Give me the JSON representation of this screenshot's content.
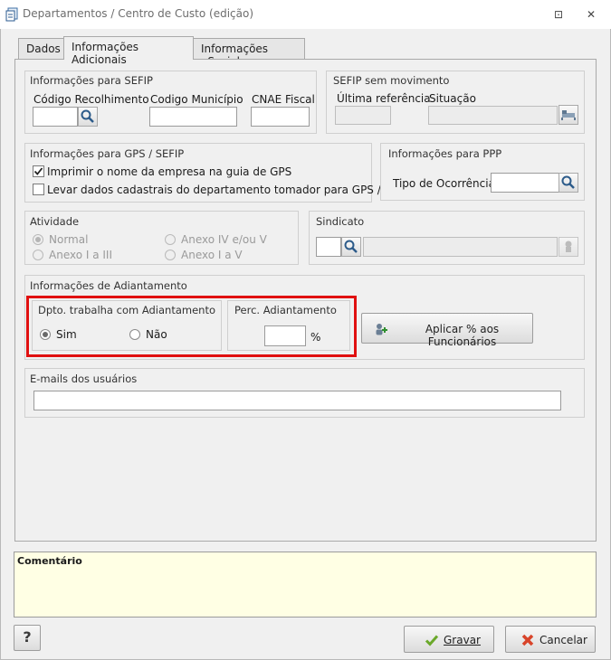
{
  "window": {
    "title": "Departamentos / Centro de Custo (edição)",
    "controls": {
      "restore": "⊡",
      "close": "✕"
    }
  },
  "tabs": [
    {
      "label": "Dados"
    },
    {
      "label": "Informações Adicionais"
    },
    {
      "label": "Informações eSocial"
    }
  ],
  "sefip": {
    "title": "Informações para SEFIP",
    "cod_recolhimento_label": "Código Recolhimento",
    "cod_municipio_label": "Codigo Município",
    "cnae_label": "CNAE Fiscal"
  },
  "sefip_mov": {
    "title": "SEFIP sem movimento",
    "ultima_ref_label": "Última referência",
    "situacao_label": "Situação"
  },
  "gps": {
    "title": "Informações para GPS / SEFIP",
    "check1_label": "Imprimir o nome da empresa na guia de GPS",
    "check2_label": "Levar dados cadastrais do departamento tomador para GPS / SEFIP"
  },
  "ppp": {
    "title": "Informações para PPP",
    "tipo_label": "Tipo de Ocorrência"
  },
  "atividade": {
    "title": "Atividade",
    "opt_normal": "Normal",
    "opt_anexo4": "Anexo IV e/ou V",
    "opt_anexo13": "Anexo I a III",
    "opt_anexo15": "Anexo I a V"
  },
  "sindicato": {
    "title": "Sindicato"
  },
  "adiantamento": {
    "title": "Informações de Adiantamento",
    "dpto_title": "Dpto. trabalha com Adiantamento",
    "sim": "Sim",
    "nao": "Não",
    "perc_title": "Perc. Adiantamento",
    "perc_unit": "%",
    "apply_button": "Aplicar % aos Funcionários"
  },
  "emails": {
    "title": "E-mails dos usuários"
  },
  "comment": {
    "title": "Comentário"
  },
  "footer": {
    "help": "?",
    "save": "Gravar",
    "cancel": "Cancelar"
  }
}
